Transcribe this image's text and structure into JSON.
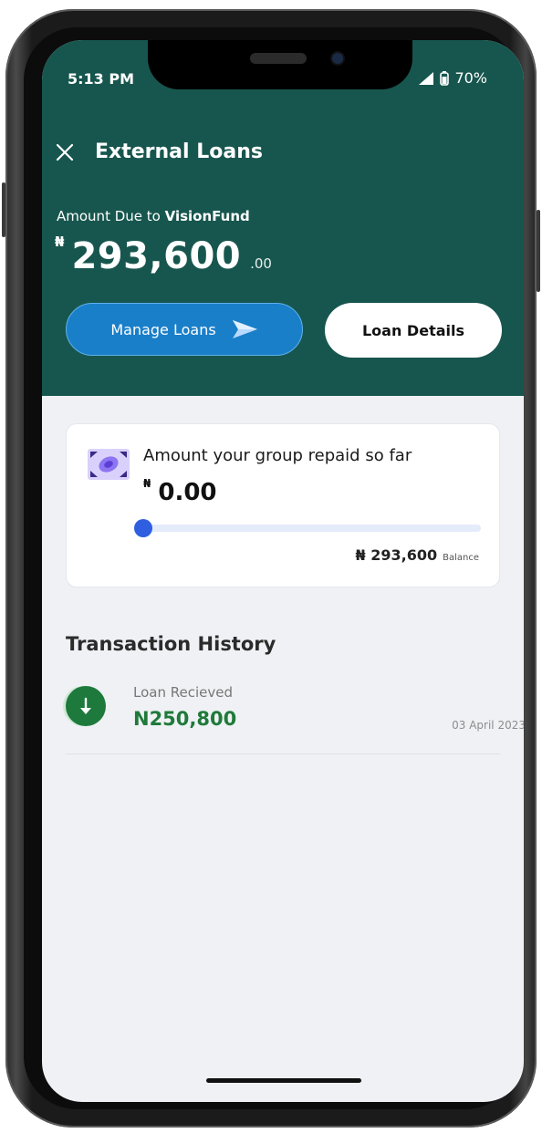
{
  "status_bar": {
    "time": "5:13 PM",
    "battery": "70%"
  },
  "header": {
    "title": "External Loans",
    "amount_due_prefix": "Amount Due to",
    "lender": "VisionFund",
    "currency_symbol": "₦",
    "amount": "293,600",
    "amount_cents": ".00",
    "manage_button": "Manage Loans",
    "details_button": "Loan Details"
  },
  "repaid_card": {
    "label": "Amount your group repaid so far",
    "currency_symbol": "₦",
    "amount": "0.00",
    "progress_fraction": 0,
    "balance_amount": "₦ 293,600",
    "balance_label": "Balance"
  },
  "history": {
    "title": "Transaction History",
    "items": [
      {
        "label": "Loan Recieved",
        "amount": "N250,800",
        "date": "03 April 2023",
        "icon": "download-arrow-icon"
      }
    ]
  },
  "colors": {
    "header_bg": "#17564e",
    "primary_button": "#1a7fc9",
    "progress": "#2f5fe0",
    "credit_green": "#1f7a3a"
  }
}
